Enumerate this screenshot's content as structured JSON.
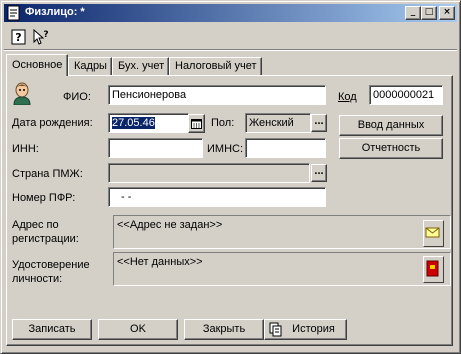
{
  "window": {
    "title": "Физлицо: *",
    "title_icon": "document-icon",
    "controls": {
      "minimize": "_",
      "maximize": "□",
      "close": "×"
    }
  },
  "toolbar": {
    "help_icon": "help-icon",
    "whats_this_icon": "whats-this-icon"
  },
  "tabs": [
    {
      "label": "Основное",
      "active": true
    },
    {
      "label": "Кадры",
      "active": false
    },
    {
      "label": "Бух. учет",
      "active": false
    },
    {
      "label": "Налоговый учет",
      "active": false
    }
  ],
  "form": {
    "fio_label": "ФИО:",
    "fio_value": "Пенсионерова",
    "code_label": "Код",
    "code_value": "0000000021",
    "birth_label": "Дата рождения:",
    "birth_value": "27.05.46",
    "sex_label": "Пол:",
    "sex_value": "Женский",
    "inn_label": "ИНН:",
    "inn_value": "",
    "imns_label": "ИМНС:",
    "imns_value": "",
    "country_label": "Страна ПМЖ:",
    "country_value": "",
    "pfr_label": "Номер ПФР:",
    "pfr_value": "-  -",
    "address_label": "Адрес по регистрации:",
    "address_value": "<<Адрес не задан>>",
    "id_label": "Удостоверение личности:",
    "id_value": "<<Нет данных>>",
    "ellipsis": "..."
  },
  "side_buttons": {
    "data_entry": "Ввод данных",
    "reports": "Отчетность"
  },
  "footer": {
    "save": "Записать",
    "ok": "OK",
    "close": "Закрыть",
    "history": "История"
  },
  "colors": {
    "titlebar_start": "#0a246a",
    "titlebar_end": "#a6caf0",
    "face": "#d4d0c8",
    "selection": "#0a246a"
  }
}
